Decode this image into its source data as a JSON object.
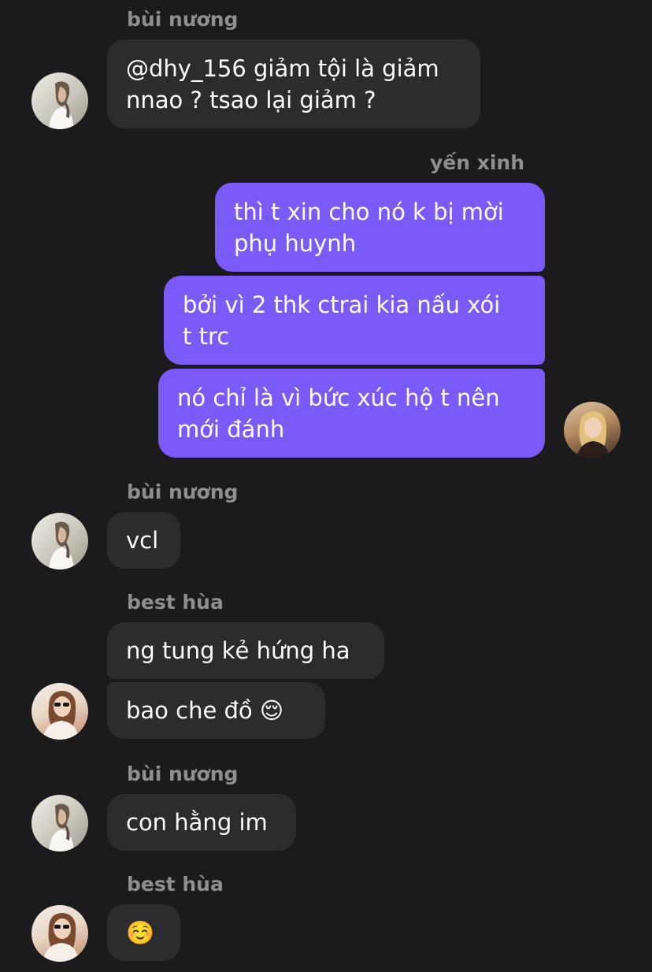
{
  "colors": {
    "background": "#1b1b1d",
    "incoming_bubble": "#2c2c2e",
    "outgoing_bubble": "#7b5af9",
    "sender_name": "#8e8e93",
    "text": "#ffffff"
  },
  "thread": {
    "g1": {
      "sender": "bùi nương",
      "msg1": "@dhy_156 giảm tội là giảm\nnnao ? tsao lại giảm ?"
    },
    "g2": {
      "sender": "yến xinh",
      "msg1": "thì t xin cho nó k bị mời\nphụ huynh",
      "msg2": "bởi vì 2 thk ctrai kia nấu xói\nt trc",
      "msg3": "nó chỉ là vì bức xúc hộ t nên\nmới đánh"
    },
    "g3": {
      "sender": "bùi nương",
      "msg1": "vcl"
    },
    "g4": {
      "sender": "best hùa",
      "msg1": "ng tung kẻ hứng ha",
      "msg2": "bao che đồ 😌"
    },
    "g5": {
      "sender": "bùi nương",
      "msg1": "con hằng im"
    },
    "g6": {
      "sender": "best hùa",
      "msg1": "☺️"
    }
  },
  "icons": {
    "avatar_bui": "profile-photo-woman-white-shirt",
    "avatar_yen": "profile-photo-woman-blonde",
    "avatar_best": "profile-photo-woman-sunglasses"
  }
}
